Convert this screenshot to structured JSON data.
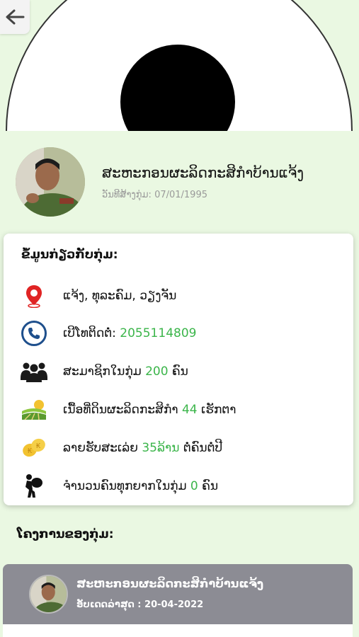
{
  "header": {
    "back_icon": "arrow-left-icon"
  },
  "profile": {
    "name": "ສະຫະກອນຜະລິດກະສິກຳບ້ານແຈ້ງ",
    "founded_label": "ວັນທີສ້າງກຸ່ມ: 07/01/1995"
  },
  "info": {
    "title": "ຂໍ້ມູນກ່ຽວກັບກຸ່ມ:",
    "location": "ແຈ້ງ, ທຸລະຄົມ, ວຽງຈັນ",
    "phone_label": "ເບີໂທຕິດຕໍ່:",
    "phone_value": "2055114809",
    "members_prefix": "ສະມາຊິກໃນກຸ່ມ",
    "members_value": "200",
    "members_suffix": "ຄົນ",
    "land_prefix": "ເນື້ອທີ່ດິນຜະລິດກະສິກຳ",
    "land_value": "44",
    "land_suffix": "ເຮັກຕາ",
    "income_prefix": "ລາຍຮັບສະເລ່ຍ",
    "income_value": "35ລ້ານ",
    "income_suffix": "ຕໍ່ຄົນຕໍ່ປີ",
    "poor_prefix": "ຈຳນວນຄົນທຸກຍາກໃນກຸ່ມ",
    "poor_value": "0",
    "poor_suffix": "ຄົນ"
  },
  "projects": {
    "title": "ໂຄງການຂອງກຸ່ມ:",
    "items": [
      {
        "name": "ສະຫະກອນຜະລິດກະສິກຳບ້ານແຈ້ງ",
        "updated": "ອັບເດດລ່າສຸດ : 20-04-2022"
      }
    ]
  },
  "colors": {
    "background": "#eaf8e2",
    "accent_green": "#3bb54a",
    "post_header": "#8c8c94"
  }
}
